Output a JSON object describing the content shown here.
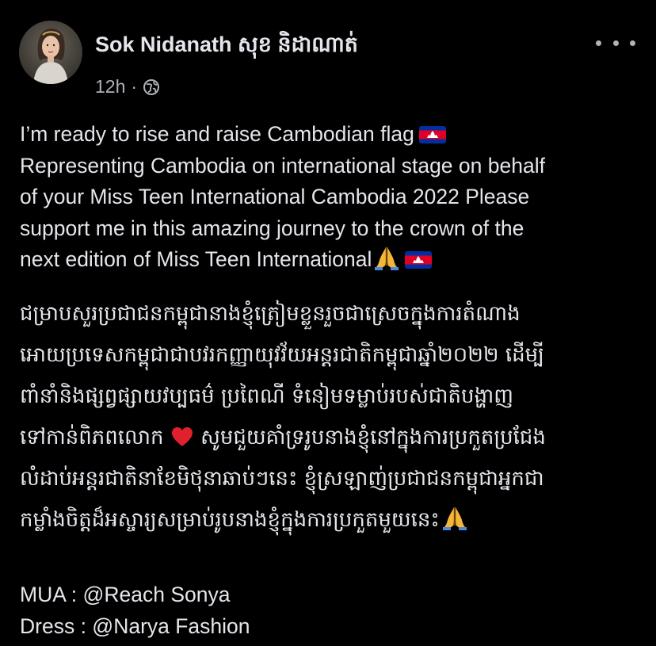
{
  "post": {
    "author": "Sok Nidanath សុខ និដាណាត់",
    "time": "12h",
    "dot": "·",
    "visibility_icon": "globe-icon",
    "more_icon": "more-horizontal-icon",
    "english_lines": [
      "I’m ready to rise and raise Cambodian flag",
      "Representing Cambodia on international stage on behalf",
      "of your Miss Teen International Cambodia 2022 Please",
      "support me in this amazing journey to the crown of the",
      "next edition of Miss Teen International"
    ],
    "khmer_lines": [
      "ជម្រាបសួរប្រជាជនកម្ពុជានាងខ្ញុំត្រៀមខ្លួនរួចជាស្រេចក្នុងការតំណាង",
      "អោយប្រទេសកម្ពុជាជាបវរកញ្ញាយុវវ័យអន្តរជាតិកម្ពុជាឆ្នាំ២០២២ ដើម្បី",
      "ពាំនាំនិងផ្សព្វផ្សាយវប្បធម៌ ប្រពៃណី ទំនៀមទម្លាប់របស់ជាតិបង្ហាញ",
      "ទៅកាន់ពិភពលោក",
      "សូមជួយគាំទ្ររូបនាងខ្ញុំនៅក្នុងការប្រកួតប្រជែង",
      "លំដាប់អន្តរជាតិនាខែមិថុនាឆាប់ៗនេះ ខ្ញុំស្រឡាញ់ប្រជាជនកម្ពុជាអ្នកជា",
      "កម្លាំងចិត្តដ៏អស្ចារ្យសម្រាប់រូបនាងខ្ញុំក្នុងការប្រកួតមួយនេះ"
    ],
    "credits": [
      "MUA : @Reach Sonya",
      "Dress : @Narya Fashion"
    ],
    "emojis": {
      "flag": "cambodia-flag-icon",
      "pray": "folded-hands-icon",
      "heart": "red-heart-icon"
    }
  },
  "colors": {
    "background": "#000000",
    "text": "#e4e6eb",
    "secondary_text": "#b0b3b8"
  }
}
